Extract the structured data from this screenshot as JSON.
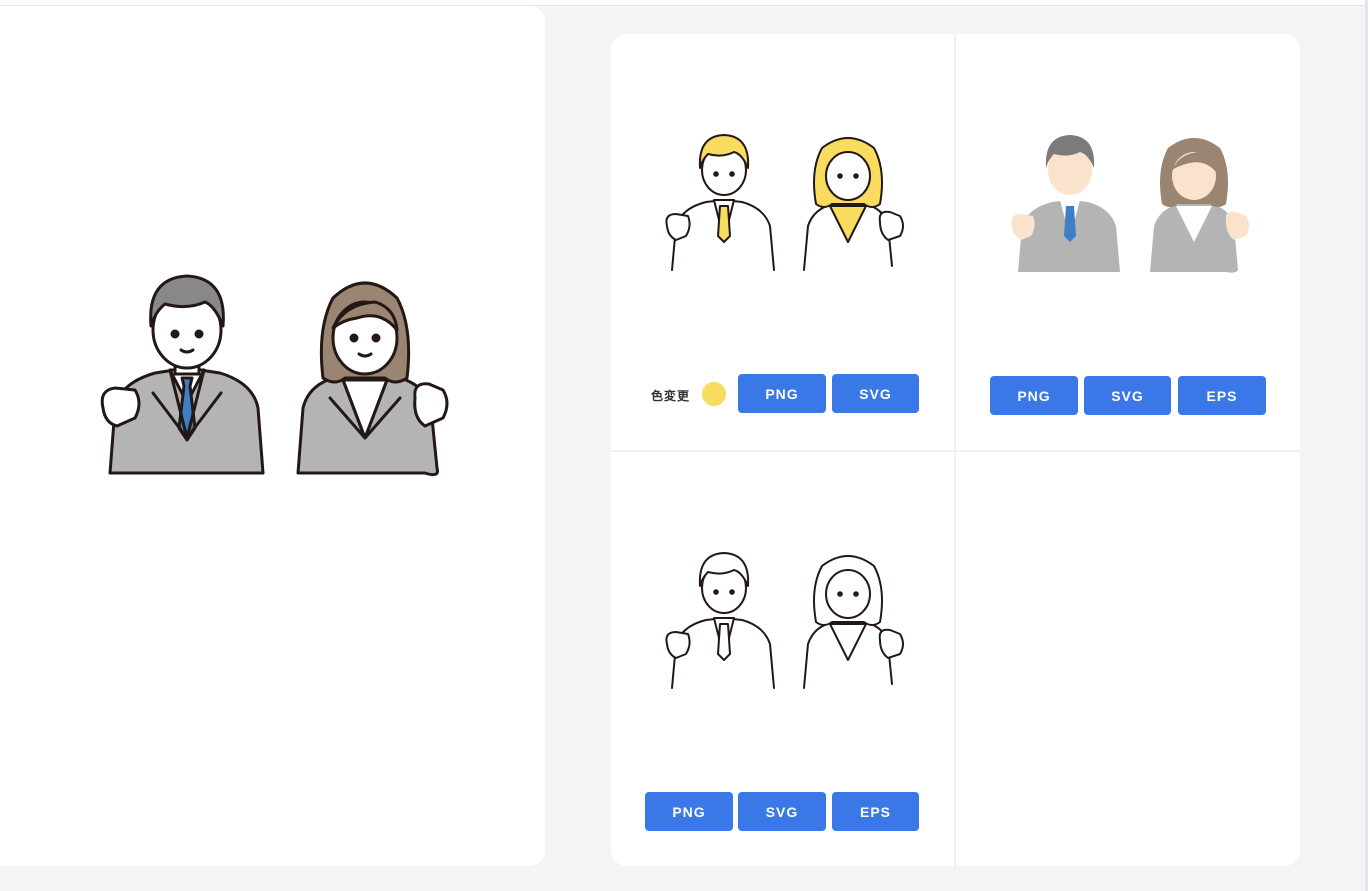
{
  "preview": {
    "illustration": "business-people-fist-pump",
    "colors": {
      "man_hair": "#888888",
      "woman_hair": "#9a8573",
      "suit": "#b4b4b4",
      "tie": "#3f7fc6",
      "outline": "#231815",
      "skin": "#ffffff"
    }
  },
  "variants": [
    {
      "style": "yellow-accent-line",
      "color_change_label": "色変更",
      "swatch_color": "#f7dc5f",
      "buttons": [
        "PNG",
        "SVG"
      ]
    },
    {
      "style": "flat-color",
      "buttons": [
        "PNG",
        "SVG",
        "EPS"
      ]
    },
    {
      "style": "line-only",
      "buttons": [
        "PNG",
        "SVG",
        "EPS"
      ]
    }
  ],
  "theme": {
    "accent": "#3a78e8",
    "background": "#f3f4f6",
    "panel": "#ffffff"
  }
}
